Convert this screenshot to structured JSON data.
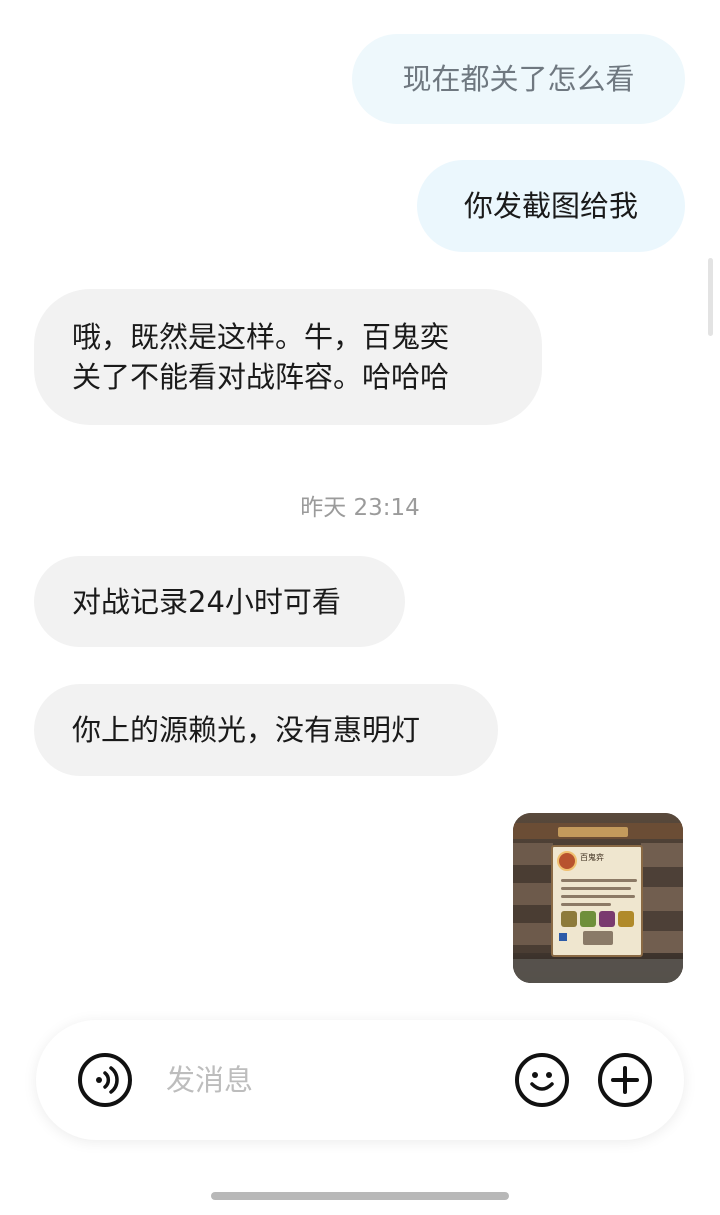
{
  "messages": [
    {
      "side": "mine",
      "text": "现在都关了怎么看"
    },
    {
      "side": "mine",
      "text": "你发截图给我"
    },
    {
      "side": "theirs",
      "text": "哦，既然是这样。牛，百鬼奕\n关了不能看对战阵容。哈哈哈"
    },
    {
      "side": "theirs",
      "text": "对战记录24小时可看"
    },
    {
      "side": "theirs",
      "text": "你上的源赖光，没有惠明灯"
    }
  ],
  "timestamp": "昨天 23:14",
  "image_message": {
    "side": "mine",
    "panel_title": "百鬼弈"
  },
  "composer": {
    "placeholder": "发消息"
  },
  "icons": {
    "voice": "voice-wave-icon",
    "emoji": "smiley-icon",
    "add": "plus-circle-icon"
  },
  "colors": {
    "mine_bubble": "#ebf7fd",
    "theirs_bubble": "#f2f2f2"
  }
}
